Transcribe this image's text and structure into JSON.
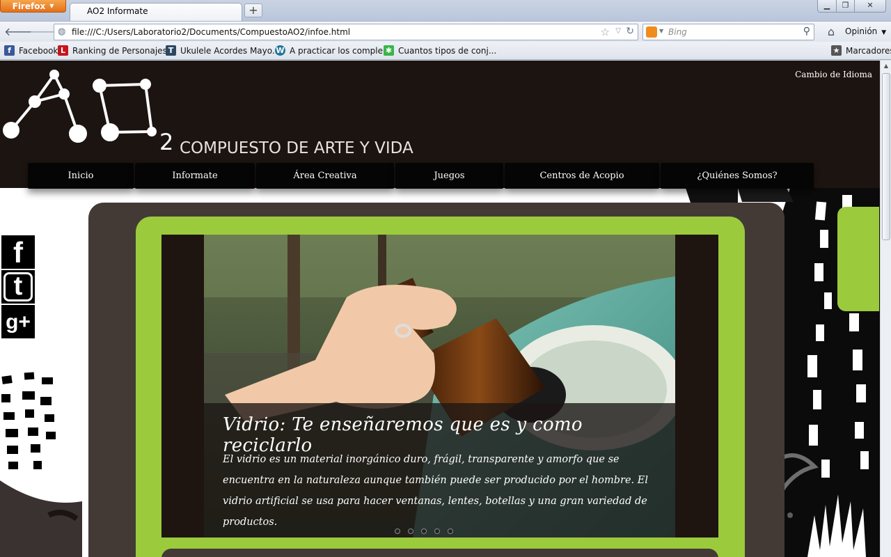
{
  "browser": {
    "app_button": "Firefox",
    "tab_title": "AO2 Informate",
    "new_tab": "+",
    "url": "file:///C:/Users/Laboratorio2/Documents/CompuestoAO2/infoe.html",
    "search_placeholder": "Bing",
    "options_label": "Opinión",
    "bookmarks": [
      {
        "label": "Facebook",
        "icon": "facebook-icon",
        "color": "#3b5998",
        "glyph": "f"
      },
      {
        "label": "Ranking de Personajes...",
        "icon": "ranking-icon",
        "color": "#c4161c",
        "glyph": "L"
      },
      {
        "label": "Ukulele Acordes Mayo...",
        "icon": "tumblr-icon",
        "color": "#2c4762",
        "glyph": "T"
      },
      {
        "label": "A practicar los comple...",
        "icon": "wordpress-icon",
        "color": "#21759b",
        "glyph": "W"
      },
      {
        "label": "Cuantos tipos de conj...",
        "icon": "star-badge-icon",
        "color": "#39b54a",
        "glyph": "✱"
      }
    ],
    "bookmarks_menu": "Marcadores"
  },
  "site": {
    "lang_switch": "Cambio de Idioma",
    "logo_sub": "2",
    "tagline": "COMPUESTO DE ARTE Y  VIDA",
    "menu": [
      "Inicio",
      "Informate",
      "Área Creativa",
      "Juegos",
      "Centros de Acopio",
      "¿Quiénes Somos?"
    ],
    "social": [
      {
        "name": "facebook",
        "glyph": "f"
      },
      {
        "name": "twitter",
        "glyph": "t"
      },
      {
        "name": "google-plus",
        "glyph": "g+"
      }
    ],
    "slide": {
      "title": "Vidrio: Te enseñaremos que es y como reciclarlo",
      "body": "El vidrio es un material inorgánico duro, frágil, transparente y amorfo que se encuentra en la naturaleza aunque también puede ser producido por el hombre. El vidrio artificial se usa para hacer ventanas, lentes, botellas y una gran variedad de productos.",
      "dots": 5
    },
    "colors": {
      "header": "#1c1410",
      "green": "#9bcb3c",
      "panel": "#433a36"
    }
  }
}
